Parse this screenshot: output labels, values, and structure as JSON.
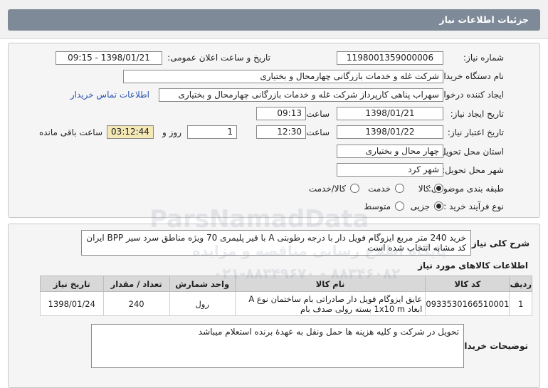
{
  "header": {
    "title": "جزئیات اطلاعات نیاز"
  },
  "form": {
    "need_number": {
      "label": "شماره نیاز:",
      "value": "1198001359000006"
    },
    "announce": {
      "label": "تاریخ و ساعت اعلان عمومی:",
      "value": "1398/01/21 - 09:15"
    },
    "buyer": {
      "label": "نام دستگاه خریدار:",
      "value": "شرکت غله و خدمات بازرگانی چهارمحال و بختیاری"
    },
    "creator": {
      "label": "ایجاد کننده درخواست:",
      "value": "سهراب پناهی کارپرداز شرکت غله و خدمات بازرگانی چهارمحال و بختیاری",
      "contact_link": "اطلاعات تماس خریدار"
    },
    "created": {
      "label": "تاریخ ایجاد نیاز:",
      "date": "1398/01/21",
      "time_label": "ساعت",
      "time": "09:13"
    },
    "validity": {
      "label": "تاریخ اعتبار نیاز:",
      "date": "1398/01/22",
      "time_label": "ساعت",
      "time": "12:30",
      "days": "1",
      "days_label": "روز و",
      "remaining": "03:12:44",
      "remaining_label": "ساعت باقی مانده"
    },
    "province": {
      "label": "استان محل تحویل:",
      "value": "چهار محال و بختیاری"
    },
    "city": {
      "label": "شهر محل تحویل:",
      "value": "شهر کرد"
    },
    "category": {
      "label": "طبقه بندی موضوعی:",
      "options": [
        "کالا",
        "خدمت",
        "کالا/خدمت"
      ],
      "selected": "کالا"
    },
    "process": {
      "label": "نوع فرآیند خرید :",
      "options": [
        "جزیی",
        "متوسط"
      ],
      "selected": "جزیی"
    }
  },
  "summary": {
    "label": "شرح کلی نیاز:",
    "text": "خرید 240 متر مربع ایزوگام فویل دار با درجه رطوبتی A با قیر پلیمری 70 ویژه مناطق سرد سیر BPP      ایران کد مشابه انتخاب شده است"
  },
  "items": {
    "title": "اطلاعات کالاهای مورد نیاز",
    "columns": [
      "ردیف",
      "کد کالا",
      "نام کالا",
      "واحد شمارش",
      "تعداد / مقدار",
      "تاریخ نیاز"
    ],
    "rows": [
      {
        "row": "1",
        "code": "0933530166510001",
        "name": "عایق ایزوگام فویل دار صادراتی بام ساختمان نوع A ابعاد 1x10 m بسته رولی صدف بام",
        "unit": "رول",
        "qty": "240",
        "date": "1398/01/24"
      }
    ]
  },
  "buyer_notes": {
    "label": "توضیحات خریدار:",
    "text": "تحویل در شرکت و کلیه هزینه ها حمل ونقل به عهدهٔ برنده استعلام میباشد"
  },
  "watermark": {
    "text": "ParsNamadData",
    "line1": "پایگاه اطلاع رسانی مناقصه و مزایده",
    "line2": "۰۲۱-۸۸۳۴۹۶۷۰ - ۸۸۳۴۶۰۸۲"
  }
}
